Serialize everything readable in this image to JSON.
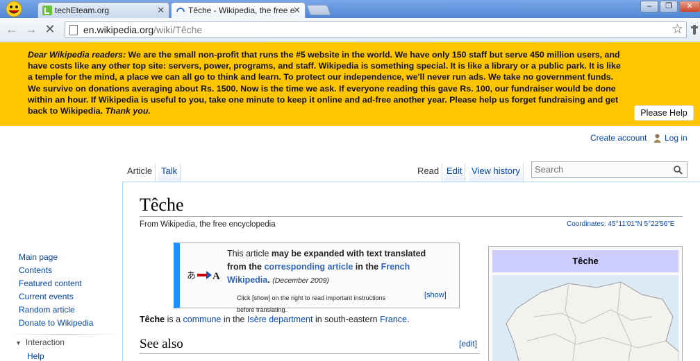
{
  "browser": {
    "tabs": [
      {
        "title": "techEteam.org",
        "active": false
      },
      {
        "title": "Têche - Wikipedia, the free e",
        "active": true
      }
    ],
    "url_host": "en.wikipedia.org",
    "url_path": "/wiki/Têche",
    "window_buttons": {
      "minimize": "–",
      "restore": "❐",
      "close": "✕"
    }
  },
  "banner": {
    "intro": "Dear Wikipedia readers:",
    "body": "We are the small non-profit that runs the #5 website in the world. We have only 150 staff but serve 450 million users, and have costs like any other top site: servers, power, programs, and staff. Wikipedia is something special. It is like a library or a public park. It is like a temple for the mind, a place we can all go to think and learn. To protect our independence, we'll never run ads. We take no government funds. We survive on donations averaging about Rs. 1500. Now is the time we ask. If everyone reading this gave Rs. 100, our fundraiser would be done within an hour. If Wikipedia is useful to you, take one minute to keep it online and ad-free another year. Please help us forget fundraising and get back to Wikipedia.",
    "outro": "Thank you.",
    "help_button": "Please Help",
    "bg_color": "#ffc600"
  },
  "personal": {
    "create_account": "Create account",
    "login": "Log in"
  },
  "tabs_left": {
    "article": "Article",
    "talk": "Talk"
  },
  "tabs_right": {
    "read": "Read",
    "edit": "Edit",
    "history": "View history"
  },
  "search": {
    "placeholder": "Search"
  },
  "article": {
    "title": "Têche",
    "tagline": "From Wikipedia, the free encyclopedia",
    "coordinates": "Coordinates: 45°11′01″N 5°22′56″E",
    "expand": {
      "line1_a": "This article ",
      "line1_b": "may be expanded with text translated",
      "line2_a": "from the ",
      "line2_link": "corresponding article",
      "line2_b": " in the ",
      "line2_link2": "French",
      "line3_link": "Wikipedia",
      "line3_dot": ".",
      "date": "(December 2009)",
      "note_line1": "Click [show] on the right to read important instructions",
      "note_line2": "before translating.",
      "show": "[show]",
      "icon_glyph": "あ",
      "icon_target": "A"
    },
    "para": {
      "subject": "Têche",
      "t1": " is a ",
      "link1": "commune",
      "t2": " in the ",
      "link2": "Isère department",
      "t3": " in south-eastern ",
      "link3": "France",
      "t4": "."
    },
    "see_also": "See also",
    "edit": "[edit]",
    "infobox_title": "Têche"
  },
  "sidebar": {
    "items": [
      "Main page",
      "Contents",
      "Featured content",
      "Current events",
      "Random article",
      "Donate to Wikipedia"
    ],
    "section": "Interaction",
    "section_items": [
      "Help"
    ]
  }
}
